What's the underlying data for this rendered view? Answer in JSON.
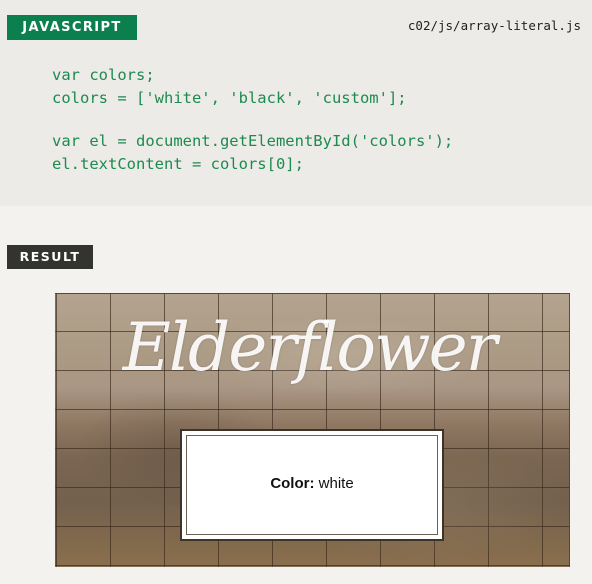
{
  "code_panel": {
    "language_label": "JAVASCRIPT",
    "file_path": "c02/js/array-literal.js",
    "lines": [
      "var colors;",
      "colors = ['white', 'black', 'custom'];",
      "",
      "var el = document.getElementById('colors');",
      "el.textContent = colors[0];"
    ]
  },
  "result": {
    "label": "RESULT",
    "heading": "Elderflower",
    "color_label": "Color:",
    "color_value": "white"
  },
  "colors": {
    "javascript_label": "#0b7f4d",
    "code_text": "#1d8a4e",
    "result_label": "#333330",
    "panel_background": "#ecebe7",
    "page_background": "#f3f2ef"
  }
}
